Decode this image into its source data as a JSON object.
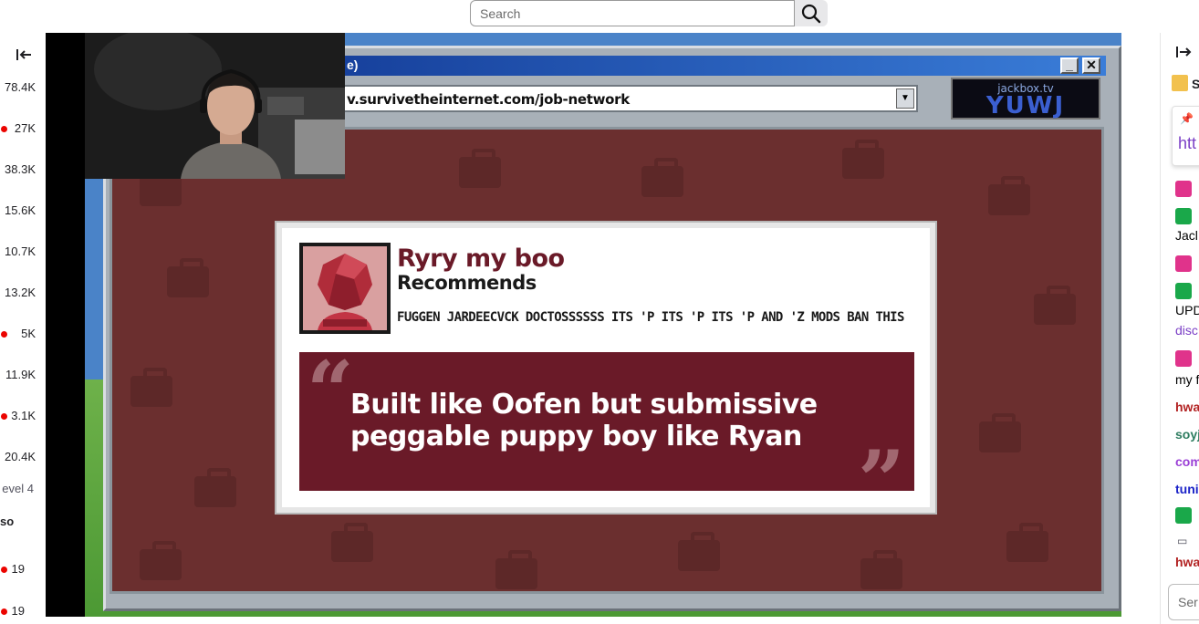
{
  "search": {
    "placeholder": "Search"
  },
  "left_rail": {
    "channels": [
      {
        "viewers": "78.4K",
        "live": false
      },
      {
        "viewers": "27K",
        "live": true
      },
      {
        "viewers": "38.3K",
        "live": false
      },
      {
        "viewers": "15.6K",
        "live": false
      },
      {
        "viewers": "10.7K",
        "live": false
      },
      {
        "viewers": "13.2K",
        "live": false
      },
      {
        "viewers": "5K",
        "live": true
      },
      {
        "viewers": "11.9K",
        "live": false
      },
      {
        "viewers": "3.1K",
        "live": true
      },
      {
        "viewers": "20.4K",
        "live": false
      },
      {
        "viewers": "evel 4",
        "live": false
      },
      {
        "viewers": "so",
        "live": false
      },
      {
        "viewers": "19",
        "live": true
      },
      {
        "viewers": "19",
        "live": true
      }
    ]
  },
  "game": {
    "title_fragment": "e)",
    "url": "v.survivetheinternet.com/job-network",
    "room_host": "jackbox.tv",
    "room_code": "YUWJ",
    "card": {
      "name": "Ryry my boo",
      "recommends": "Recommends",
      "job": "FUGGEN JARDEECVCK DOCTOSSSSSS ITS 'P ITS 'P ITS 'P AND 'Z MODS BAN THIS",
      "quote_line1": "Built like Oofen but submissive",
      "quote_line2": "peggable puppy boy like Ryan"
    }
  },
  "chat": {
    "header_fragment": "S",
    "pinned_link": "htt",
    "lines": [
      {
        "text": "Jacl",
        "color": "#1f1f23"
      },
      {
        "text": "UPD",
        "color": "#1f1f23"
      },
      {
        "text": "disc",
        "color": "#7b3fc6"
      },
      {
        "text": "my f",
        "color": "#1f1f23"
      },
      {
        "text": "hwa",
        "color": "#b22222"
      },
      {
        "text": "soyj",
        "color": "#2e7d60"
      },
      {
        "text": "com",
        "color": "#9b3fd6"
      },
      {
        "text": "tuni",
        "color": "#1b23c8"
      },
      {
        "text": "hwa",
        "color": "#b22222"
      }
    ],
    "input_placeholder": "Ser"
  },
  "colors": {
    "live_dot": "#eb0400",
    "page_bg": "#6b2f2f",
    "quote_bg": "#6a1a28",
    "name_color": "#6a1a28"
  }
}
